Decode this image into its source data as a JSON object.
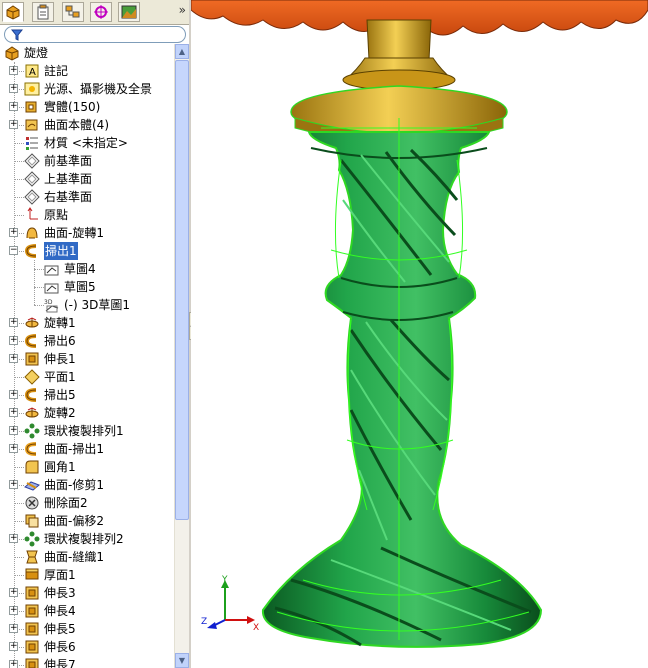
{
  "tabs": [
    {
      "name": "featuremanager-tab",
      "icon": "featuremanager-icon",
      "active": true
    },
    {
      "name": "propertymanager-tab",
      "icon": "propertymanager-icon"
    },
    {
      "name": "configurationmanager-tab",
      "icon": "configurationmanager-icon"
    },
    {
      "name": "dimxpert-tab",
      "icon": "dimxpert-icon"
    },
    {
      "name": "display-manager-tab",
      "icon": "display-manager-icon"
    }
  ],
  "more_label": "»",
  "filter": {
    "icon": "filter-icon"
  },
  "tree": [
    {
      "label": "旋燈",
      "icon": "part",
      "level": 0,
      "expander": ""
    },
    {
      "label": "註記",
      "icon": "annotation",
      "level": 1,
      "expander": "+"
    },
    {
      "label": "光源、攝影機及全景",
      "icon": "lights",
      "level": 1,
      "expander": "+"
    },
    {
      "label": "實體(150)",
      "icon": "solid",
      "level": 1,
      "expander": "+"
    },
    {
      "label": "曲面本體(4)",
      "icon": "surface-bodies",
      "level": 1,
      "expander": "+"
    },
    {
      "label": "材質 <未指定>",
      "icon": "material",
      "level": 1,
      "expander": ""
    },
    {
      "label": "前基準面",
      "icon": "plane",
      "level": 1,
      "expander": ""
    },
    {
      "label": "上基準面",
      "icon": "plane",
      "level": 1,
      "expander": ""
    },
    {
      "label": "右基準面",
      "icon": "plane",
      "level": 1,
      "expander": ""
    },
    {
      "label": "原點",
      "icon": "origin",
      "level": 1,
      "expander": ""
    },
    {
      "label": "曲面-旋轉1",
      "icon": "surface-revolve",
      "level": 1,
      "expander": "+"
    },
    {
      "label": "掃出1",
      "icon": "sweep",
      "level": 1,
      "expander": "−",
      "selected": true
    },
    {
      "label": "草圖4",
      "icon": "sketch",
      "level": 2,
      "expander": ""
    },
    {
      "label": "草圖5",
      "icon": "sketch",
      "level": 2,
      "expander": ""
    },
    {
      "label": "(-) 3D草圖1",
      "icon": "sketch3d",
      "level": 2,
      "expander": ""
    },
    {
      "label": "旋轉1",
      "icon": "revolve",
      "level": 1,
      "expander": "+"
    },
    {
      "label": "掃出6",
      "icon": "sweep",
      "level": 1,
      "expander": "+"
    },
    {
      "label": "伸長1",
      "icon": "extrude",
      "level": 1,
      "expander": "+"
    },
    {
      "label": "平面1",
      "icon": "plane-feature",
      "level": 1,
      "expander": ""
    },
    {
      "label": "掃出5",
      "icon": "sweep",
      "level": 1,
      "expander": "+"
    },
    {
      "label": "旋轉2",
      "icon": "revolve",
      "level": 1,
      "expander": "+"
    },
    {
      "label": "環狀複製排列1",
      "icon": "circular-pattern",
      "level": 1,
      "expander": "+"
    },
    {
      "label": "曲面-掃出1",
      "icon": "surface-sweep",
      "level": 1,
      "expander": "+"
    },
    {
      "label": "圓角1",
      "icon": "fillet",
      "level": 1,
      "expander": ""
    },
    {
      "label": "曲面-修剪1",
      "icon": "surface-trim",
      "level": 1,
      "expander": "+"
    },
    {
      "label": "刪除面2",
      "icon": "delete-face",
      "level": 1,
      "expander": ""
    },
    {
      "label": "曲面-偏移2",
      "icon": "surface-offset",
      "level": 1,
      "expander": ""
    },
    {
      "label": "環狀複製排列2",
      "icon": "circular-pattern",
      "level": 1,
      "expander": "+"
    },
    {
      "label": "曲面-縫織1",
      "icon": "surface-knit",
      "level": 1,
      "expander": ""
    },
    {
      "label": "厚面1",
      "icon": "thicken",
      "level": 1,
      "expander": ""
    },
    {
      "label": "伸長3",
      "icon": "extrude",
      "level": 1,
      "expander": "+"
    },
    {
      "label": "伸長4",
      "icon": "extrude",
      "level": 1,
      "expander": "+"
    },
    {
      "label": "伸長5",
      "icon": "extrude",
      "level": 1,
      "expander": "+"
    },
    {
      "label": "伸長6",
      "icon": "extrude",
      "level": 1,
      "expander": "+"
    },
    {
      "label": "伸長7",
      "icon": "extrude",
      "level": 1,
      "expander": "+"
    }
  ],
  "triad": {
    "x_label": "X",
    "y_label": "Y",
    "z_label": "Z"
  },
  "colors": {
    "lamp_body": "#1e9a45",
    "lamp_body_dark": "#0d6a2a",
    "edge_highlight": "#33ff22",
    "shade": "#e35a1c",
    "gold": "#d8a820",
    "selection": "#316ac5"
  }
}
